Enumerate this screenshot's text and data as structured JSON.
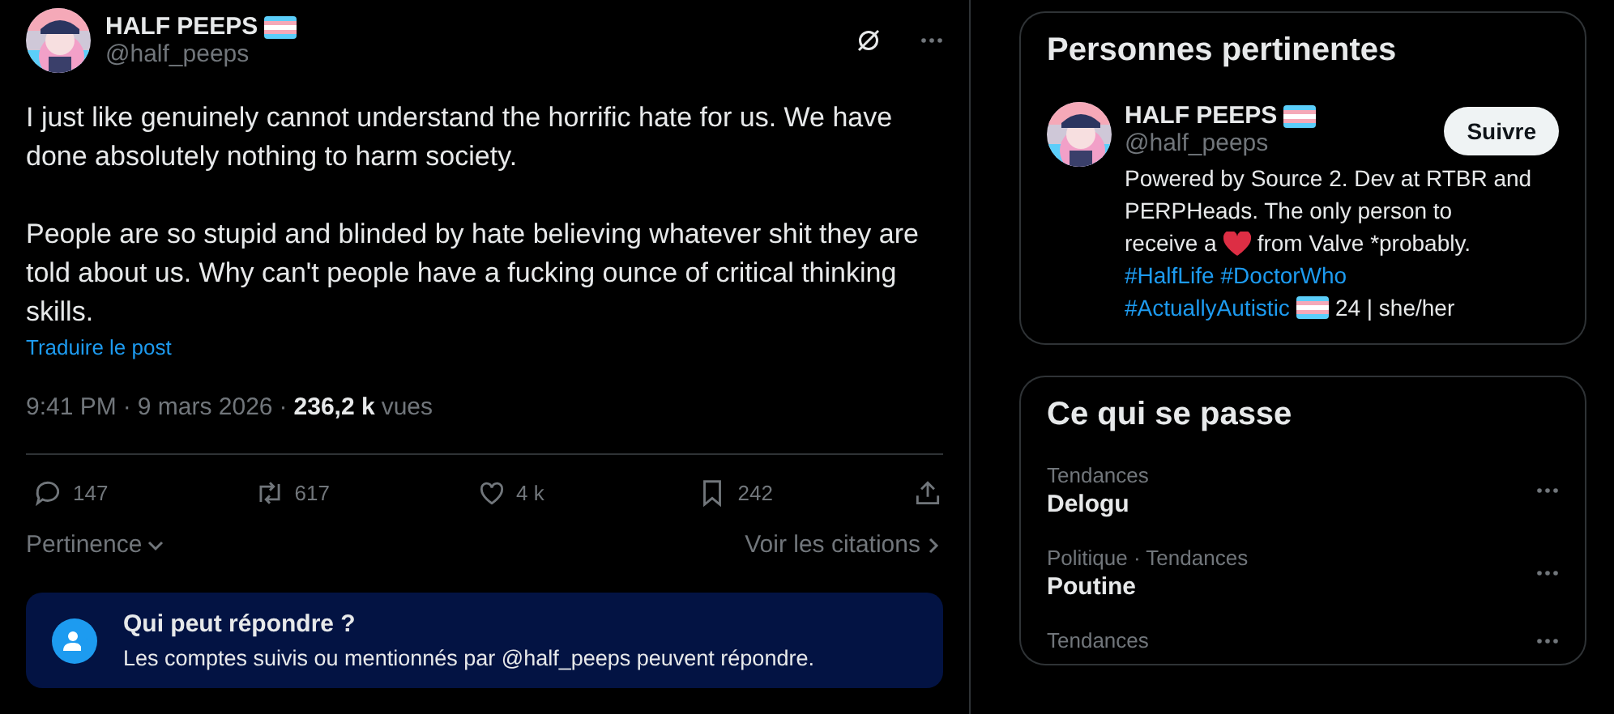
{
  "post": {
    "author": {
      "name": "HALF PEEPS",
      "handle": "@half_peeps",
      "flag": true
    },
    "paragraphs": [
      "I just like genuinely cannot understand the horrific hate for us.  We have done absolutely nothing to harm society.",
      "People are so stupid and blinded by hate believing whatever shit they are told about us.  Why can't people have a fucking ounce of critical thinking skills."
    ],
    "translate": "Traduire le post",
    "separator": "·",
    "time": "9:41 PM",
    "date": "9 mars 2026",
    "views_count": "236,2 k",
    "views_label": "vues",
    "actions": [
      {
        "kind": "reply",
        "count": "147"
      },
      {
        "kind": "repost",
        "count": "617"
      },
      {
        "kind": "like",
        "count": "4 k"
      },
      {
        "kind": "bookmark",
        "count": "242"
      },
      {
        "kind": "share"
      }
    ],
    "sort": "Pertinence",
    "quotes": "Voir les citations",
    "reply_notice": {
      "title": "Qui peut répondre ?",
      "text": "Les comptes suivis ou mentionnés par @half_peeps peuvent répondre."
    }
  },
  "relevant_people": {
    "title": "Personnes pertinentes",
    "person": {
      "name": "HALF PEEPS",
      "handle": "@half_peeps",
      "flag": true,
      "follow": "Suivre",
      "bio": [
        [
          {
            "kind": "text",
            "text": "Powered by Source 2. Dev at RTBR and"
          }
        ],
        [
          {
            "kind": "text",
            "text": "PERPHeads. The only person to"
          }
        ],
        [
          {
            "kind": "text",
            "text": "receive a"
          },
          {
            "kind": "heart"
          },
          {
            "kind": "text",
            "text": "from Valve *probably."
          }
        ],
        [
          {
            "kind": "hashtag",
            "text": "#HalfLife"
          },
          {
            "kind": "hashtag",
            "text": "#DoctorWho"
          }
        ],
        [
          {
            "kind": "hashtag",
            "text": "#ActuallyAutistic"
          },
          {
            "kind": "flag"
          },
          {
            "kind": "text",
            "text": "24 | she/her"
          }
        ]
      ]
    }
  },
  "trends": {
    "title": "Ce qui se passe",
    "items": [
      {
        "context": "Tendances",
        "name": "Delogu"
      },
      {
        "context": "Politique · Tendances",
        "name": "Poutine"
      },
      {
        "context": "Tendances"
      }
    ]
  }
}
